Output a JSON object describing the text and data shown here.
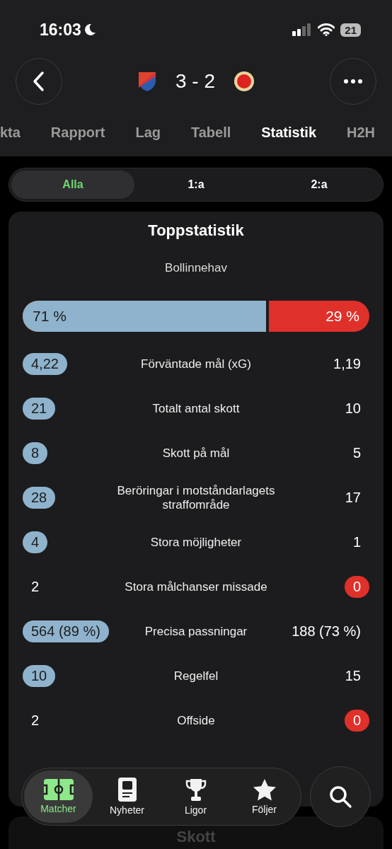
{
  "status_bar": {
    "time": "16:03",
    "battery": "21"
  },
  "header": {
    "score": "3 - 2"
  },
  "tabs": [
    {
      "label": "kta",
      "selected": false
    },
    {
      "label": "Rapport",
      "selected": false
    },
    {
      "label": "Lag",
      "selected": false
    },
    {
      "label": "Tabell",
      "selected": false
    },
    {
      "label": "Statistik",
      "selected": true
    },
    {
      "label": "H2H",
      "selected": false
    }
  ],
  "periods": [
    {
      "label": "Alla",
      "selected": true
    },
    {
      "label": "1:a",
      "selected": false
    },
    {
      "label": "2:a",
      "selected": false
    }
  ],
  "card": {
    "title": "Toppstatistik",
    "possession": {
      "label": "Bollinnehav",
      "home": "71 %",
      "away": "29 %",
      "level": 0.71
    },
    "rows": [
      {
        "home": "4,22",
        "label": "Förväntade mål (xG)",
        "away": "1,19",
        "home_highlighted": true,
        "away_highlighted": false
      },
      {
        "home": "21",
        "label": "Totalt antal skott",
        "away": "10",
        "home_highlighted": true,
        "away_highlighted": false
      },
      {
        "home": "8",
        "label": "Skott på mål",
        "away": "5",
        "home_highlighted": true,
        "away_highlighted": false
      },
      {
        "home": "28",
        "label": "Beröringar i motståndarlagets straffområde",
        "away": "17",
        "home_highlighted": true,
        "away_highlighted": false
      },
      {
        "home": "4",
        "label": "Stora möjligheter",
        "away": "1",
        "home_highlighted": true,
        "away_highlighted": false
      },
      {
        "home": "2",
        "label": "Stora målchanser missade",
        "away": "0",
        "home_highlighted": false,
        "away_highlighted": true
      },
      {
        "home": "564 (89 %)",
        "label": "Precisa passningar",
        "away": "188 (73 %)",
        "home_highlighted": true,
        "away_highlighted": false
      },
      {
        "home": "10",
        "label": "Regelfel",
        "away": "15",
        "home_highlighted": true,
        "away_highlighted": false
      },
      {
        "home": "2",
        "label": "Offside",
        "away": "0",
        "home_highlighted": false,
        "away_highlighted": true
      }
    ]
  },
  "next_card": {
    "title": "Skott"
  },
  "nav": [
    {
      "label": "Matcher",
      "kind": "matches",
      "selected": true
    },
    {
      "label": "Nyheter",
      "kind": "news",
      "selected": false
    },
    {
      "label": "Ligor",
      "kind": "leagues",
      "selected": false
    },
    {
      "label": "Följer",
      "kind": "following",
      "selected": false
    }
  ]
}
